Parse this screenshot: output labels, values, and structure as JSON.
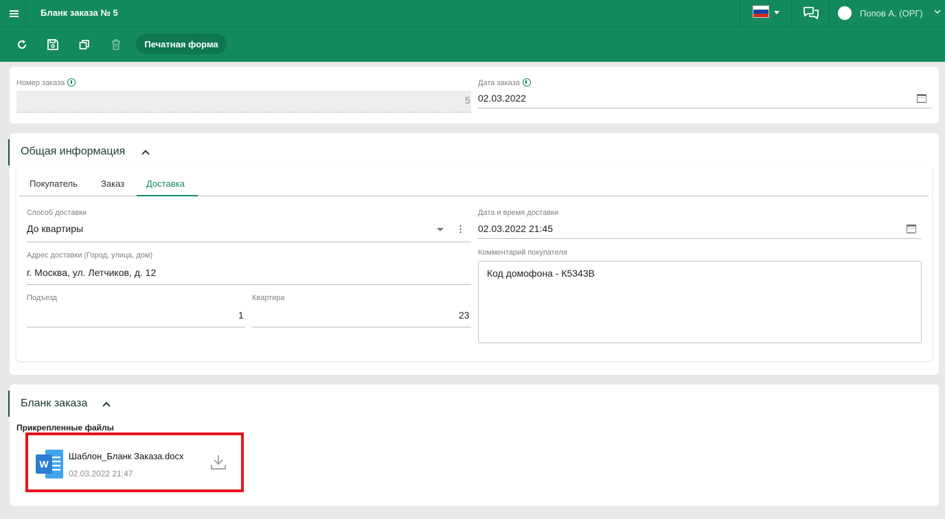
{
  "header": {
    "title": "Бланк заказа № 5",
    "user_name": "Попов А. (ОРГ)"
  },
  "toolbar": {
    "print_label": "Печатная форма"
  },
  "order": {
    "number_label": "Номер заказа",
    "number_value": "5",
    "date_label": "Дата заказа",
    "date_value": "02.03.2022"
  },
  "general": {
    "title": "Общая информация",
    "tabs": [
      {
        "label": "Покупатель",
        "active": false
      },
      {
        "label": "Заказ",
        "active": false
      },
      {
        "label": "Доставка",
        "active": true
      }
    ],
    "delivery_method_label": "Способ доставки",
    "delivery_method_value": "До квартиры",
    "delivery_datetime_label": "Дата и время доставки",
    "delivery_datetime_value": "02.03.2022 21:45",
    "address_label": "Адрес доставки (Город, улица, дом)",
    "address_value": "г. Москва, ул. Летчиков, д. 12",
    "comment_label": "Комментарий покупателя",
    "comment_value": "Код домофона - К5343В",
    "entrance_label": "Подъезд",
    "entrance_value": "1",
    "apartment_label": "Квартира",
    "apartment_value": "23"
  },
  "blank": {
    "title": "Бланк заказа",
    "attached_label": "Прикрепленные файлы",
    "file_name": "Шаблон_Бланк Заказа.docx",
    "file_date": "02.03.2022 21:47"
  },
  "colors": {
    "brand": "#138a5e",
    "highlight": "#e8141b"
  }
}
